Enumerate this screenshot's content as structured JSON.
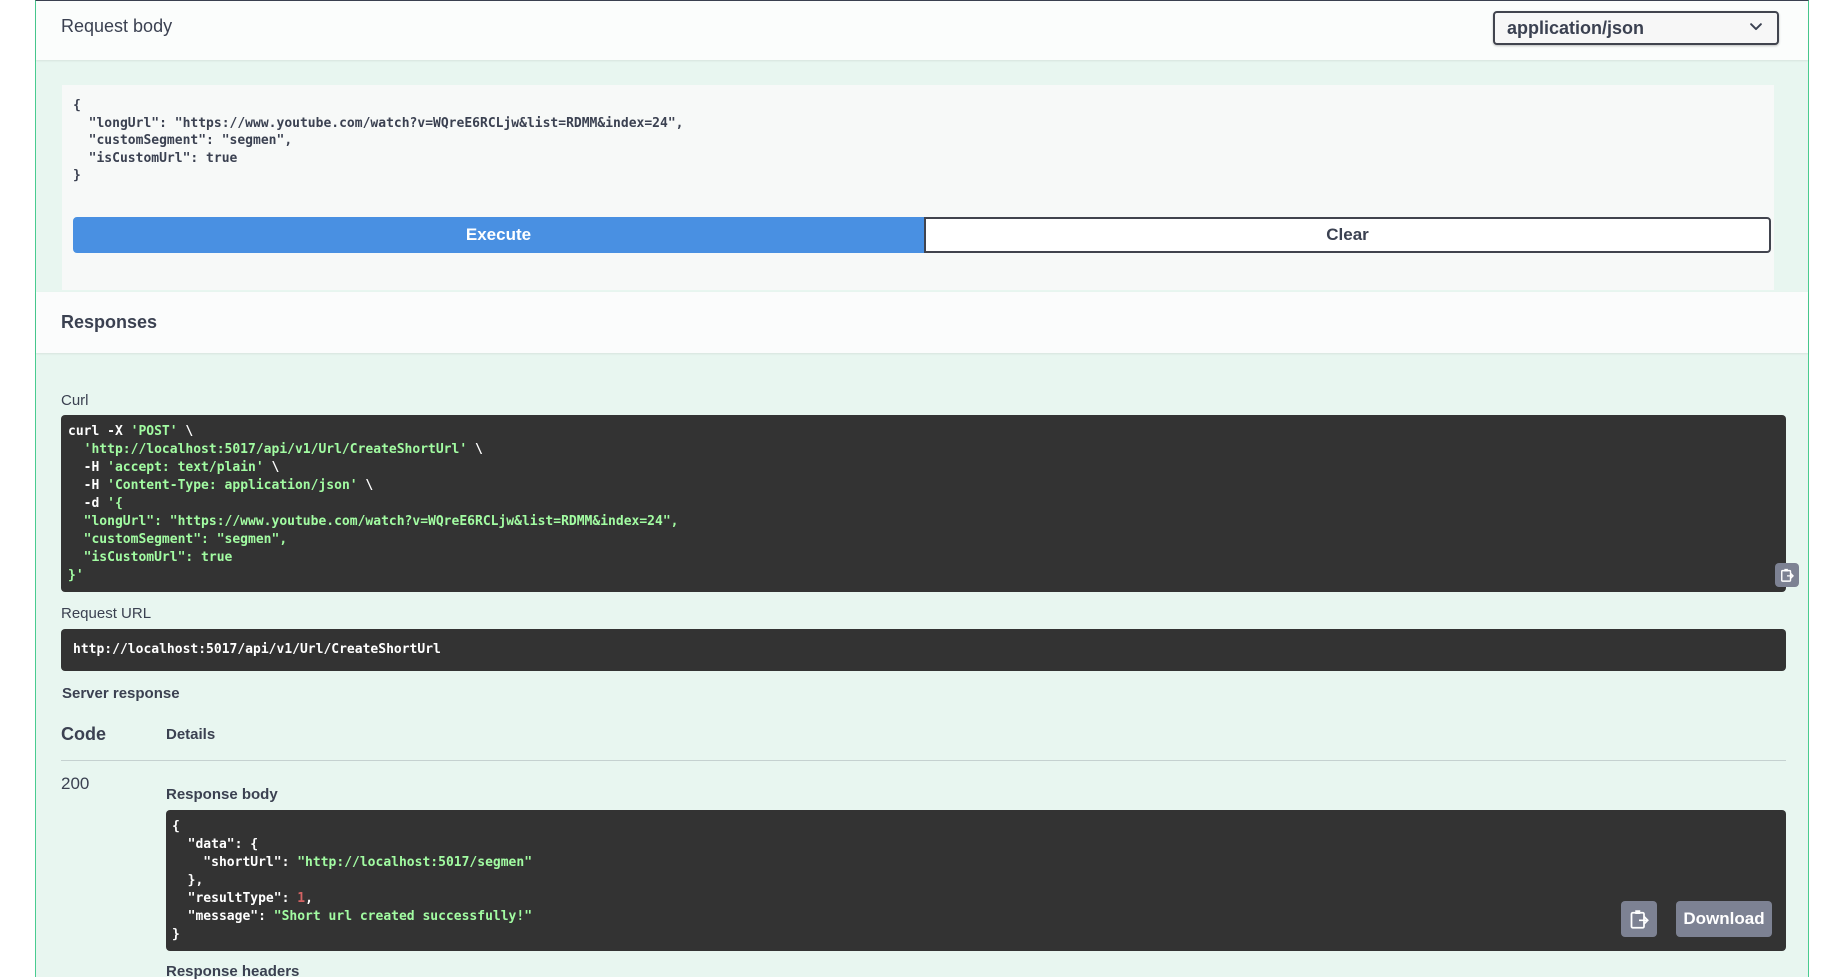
{
  "request_body": {
    "title": "Request body",
    "content_type": "application/json",
    "body_lines": [
      "{",
      "  \"longUrl\": \"https://www.youtube.com/watch?v=WQreE6RCLjw&list=RDMM&index=24\",",
      "  \"customSegment\": \"segmen\",",
      "  \"isCustomUrl\": true",
      "}"
    ]
  },
  "buttons": {
    "execute": "Execute",
    "clear": "Clear"
  },
  "responses": {
    "title": "Responses",
    "curl_label": "Curl",
    "curl": {
      "line1_cmd": "curl -X ",
      "line1_str": "'POST'",
      "line1_tail": " \\",
      "line2_str": "  'http://localhost:5017/api/v1/Url/CreateShortUrl'",
      "line2_tail": " \\",
      "line3_cmd": "  -H ",
      "line3_str": "'accept: text/plain'",
      "line3_tail": " \\",
      "line4_cmd": "  -H ",
      "line4_str": "'Content-Type: application/json'",
      "line4_tail": " \\",
      "line5_cmd": "  -d ",
      "line5_str": "'{",
      "line6_str": "  \"longUrl\": \"https://www.youtube.com/watch?v=WQreE6RCLjw&list=RDMM&index=24\",",
      "line7_str": "  \"customSegment\": \"segmen\",",
      "line8_str": "  \"isCustomUrl\": true",
      "line9_str": "}'"
    },
    "request_url_label": "Request URL",
    "request_url": "http://localhost:5017/api/v1/Url/CreateShortUrl",
    "server_response_label": "Server response",
    "code_header": "Code",
    "details_header": "Details",
    "status_code": "200",
    "response_body_label": "Response body",
    "response_body": {
      "l1": "{",
      "l2_key": "  \"data\"",
      "l2_tail": ": {",
      "l3_key": "    \"shortUrl\"",
      "l3_sep": ": ",
      "l3_val": "\"http://localhost:5017/segmen\"",
      "l4": "  },",
      "l5_key": "  \"resultType\"",
      "l5_sep": ": ",
      "l5_val": "1",
      "l5_tail": ",",
      "l6_key": "  \"message\"",
      "l6_sep": ": ",
      "l6_val": "\"Short url created successfully!\"",
      "l7": "}"
    },
    "download_label": "Download",
    "response_headers_label": "Response headers"
  },
  "icons": {
    "chevron": "chevron-down-icon",
    "copy": "copy-to-clipboard-icon"
  }
}
